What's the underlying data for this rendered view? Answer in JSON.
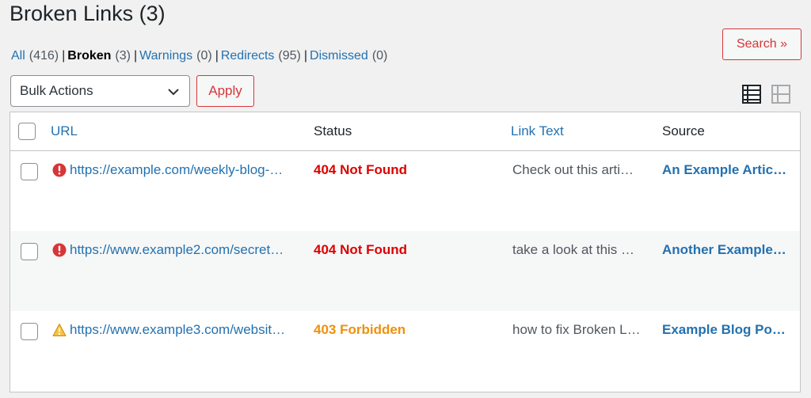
{
  "page": {
    "title": "Broken Links (3)"
  },
  "filters": [
    {
      "label": "All",
      "count": "(416)",
      "current": false
    },
    {
      "label": "Broken",
      "count": "(3)",
      "current": true
    },
    {
      "label": "Warnings",
      "count": "(0)",
      "current": false
    },
    {
      "label": "Redirects",
      "count": "(95)",
      "current": false
    },
    {
      "label": "Dismissed",
      "count": "(0)",
      "current": false
    }
  ],
  "filter_separator": "|",
  "search_button": "Search »",
  "bulk_actions": {
    "selected": "Bulk Actions",
    "apply_label": "Apply"
  },
  "view_modes": [
    {
      "icon": "list-view-icon",
      "active": true
    },
    {
      "icon": "excerpt-view-icon",
      "active": false
    }
  ],
  "table": {
    "columns": {
      "url": "URL",
      "status": "Status",
      "link_text": "Link Text",
      "source": "Source"
    },
    "rows": [
      {
        "icon": "error-icon",
        "url": "https://example.com/weekly-blog-…",
        "status": "404 Not Found",
        "status_type": "error",
        "link_text": "Check out this arti…",
        "source": "An Example Artic…"
      },
      {
        "icon": "error-icon",
        "url": "https://www.example2.com/secret…",
        "status": "404 Not Found",
        "status_type": "error",
        "link_text": "take a look at this …",
        "source": "Another Example…"
      },
      {
        "icon": "warning-icon",
        "url": "https://www.example3.com/websit…",
        "status": "403 Forbidden",
        "status_type": "warning",
        "link_text": "how to fix Broken L…",
        "source": "Example Blog Po…"
      }
    ]
  },
  "colors": {
    "link": "#2271b1",
    "error": "#e00000",
    "warning": "#f0900a",
    "accent_button": "#d63638"
  }
}
